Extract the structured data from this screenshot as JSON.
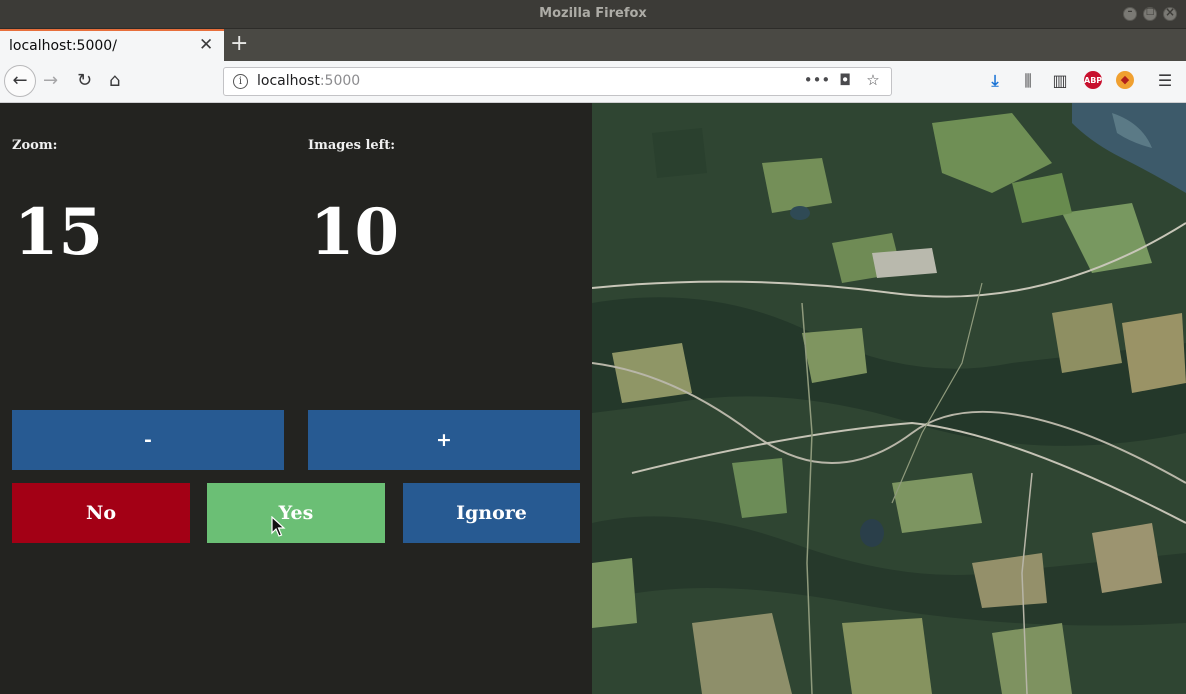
{
  "window": {
    "title": "Mozilla Firefox"
  },
  "tabs": [
    {
      "title": "localhost:5000/"
    }
  ],
  "navbar": {
    "url_host": "localhost",
    "url_port": ":5000"
  },
  "toolbar": {
    "abp_label": "ABP"
  },
  "app": {
    "zoom_label": "Zoom:",
    "zoom_value": "15",
    "images_left_label": "Images left:",
    "images_left_value": "10",
    "minus_label": "-",
    "plus_label": "+",
    "no_label": "No",
    "yes_label": "Yes",
    "ignore_label": "Ignore"
  },
  "colors": {
    "background": "#232320",
    "blue_button": "#275a92",
    "no_button": "#a30015",
    "yes_button": "#6bbf75"
  }
}
